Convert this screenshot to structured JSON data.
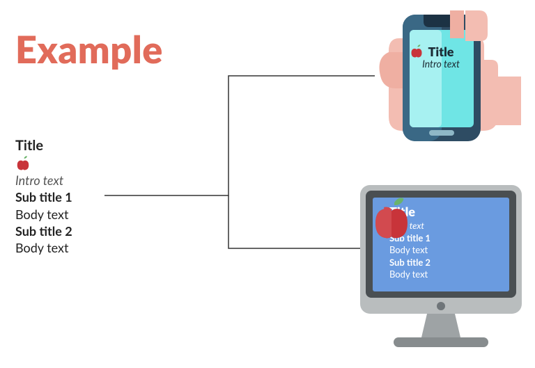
{
  "heading": "Example",
  "content": {
    "title": "Title",
    "intro": "Intro text",
    "sub1": "Sub title 1",
    "body1": "Body text",
    "sub2": "Sub title 2",
    "body2": "Body text"
  },
  "phone": {
    "title": "Title",
    "intro": "Intro text"
  },
  "monitor": {
    "title": "Title",
    "intro": "Intro text",
    "sub1": "Sub title 1",
    "body1": "Body text",
    "sub2": "Sub title 2",
    "body2": "Body text"
  },
  "colors": {
    "accent": "#E16B5A",
    "monitorScreen": "#6A9BE0",
    "phoneScreen": "#6FE5E5",
    "applered": "#C8343A",
    "appleleaf": "#6BB36B"
  }
}
